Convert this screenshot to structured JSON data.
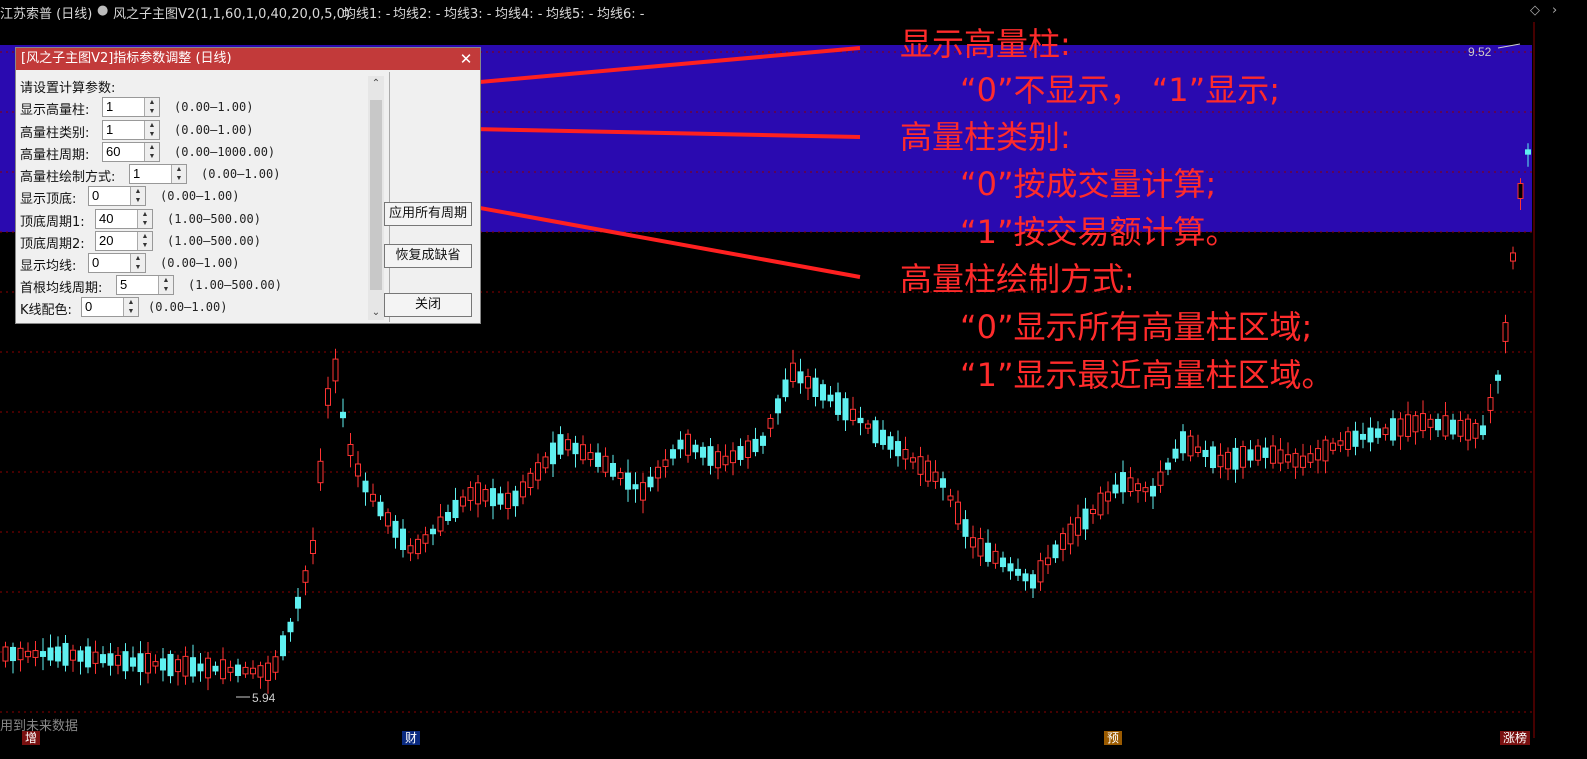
{
  "header": {
    "stock_title": "江苏索普 (日线)",
    "indicator": "风之子主图V2(1,1,60,1,0,40,20,0,5,0)",
    "ma_labels": [
      "均线1: -",
      "均线2: -",
      "均线3: -",
      "均线4: -",
      "均线5: -",
      "均线6: -"
    ]
  },
  "dialog": {
    "title": "[风之子主图V2]指标参数调整 (日线)",
    "close_icon": "close-icon",
    "prompt": "请设置计算参数:",
    "params": [
      {
        "label": "显示高量柱:",
        "value": "1",
        "range": "(0.00—1.00)"
      },
      {
        "label": "高量柱类别:",
        "value": "1",
        "range": "(0.00—1.00)"
      },
      {
        "label": "高量柱周期:",
        "value": "60",
        "range": "(0.00—1000.00)"
      },
      {
        "label": "高量柱绘制方式:",
        "value": "1",
        "range": "(0.00—1.00)"
      },
      {
        "label": "显示顶底:",
        "value": "0",
        "range": "(0.00—1.00)"
      },
      {
        "label": "顶底周期1:",
        "value": "40",
        "range": "(1.00—500.00)"
      },
      {
        "label": "顶底周期2:",
        "value": "20",
        "range": "(1.00—500.00)"
      },
      {
        "label": "显示均线:",
        "value": "0",
        "range": "(0.00—1.00)"
      },
      {
        "label": "首根均线周期:",
        "value": "5",
        "range": "(1.00—500.00)"
      },
      {
        "label": "K线配色:",
        "value": "0",
        "range": "(0.00—1.00)"
      }
    ],
    "buttons": {
      "apply_all": "应用所有周期",
      "restore_default": "恢复成缺省",
      "close": "关闭"
    }
  },
  "annotations": [
    "显示高量柱:",
    "“0”不显示， “1”显示;",
    "高量柱类别:",
    "“0”按成交量计算;",
    "“1”按交易额计算。",
    "高量柱绘制方式:",
    "“0”显示所有高量柱区域;",
    "“1”显示最近高量柱区域。"
  ],
  "chart": {
    "high_price": "9.52",
    "low_price": "5.94",
    "bottom_note": "用到未来数据",
    "markers": [
      "增",
      "财",
      "预",
      "涨榜"
    ],
    "colors": {
      "up": "#ff3333",
      "down": "#5ff0f0",
      "band": "#2a0ab0",
      "annotation": "#ff2b2b",
      "grid": "#8b0000"
    }
  }
}
